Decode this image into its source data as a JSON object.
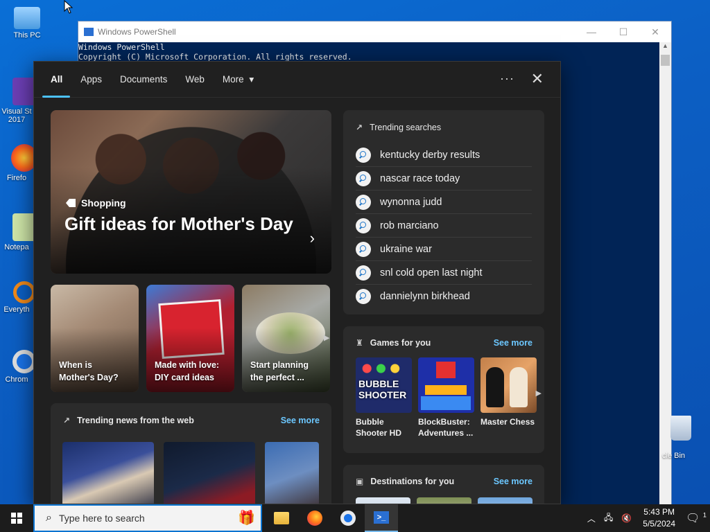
{
  "desktop": {
    "icons": [
      {
        "label": "This PC"
      },
      {
        "label": "Visual St 2017"
      },
      {
        "label": "Firefo"
      },
      {
        "label": "Notepa"
      },
      {
        "label": "Everyth"
      },
      {
        "label": "Chrom"
      }
    ],
    "recycle_bin": "cle Bin"
  },
  "powershell": {
    "title": "Windows PowerShell",
    "lines": [
      "Windows PowerShell",
      "Copyright (C) Microsoft Corporation. All rights reserved."
    ]
  },
  "search_panel": {
    "tabs": [
      {
        "label": "All",
        "active": true
      },
      {
        "label": "Apps"
      },
      {
        "label": "Documents"
      },
      {
        "label": "Web"
      },
      {
        "label": "More"
      }
    ],
    "more_caret": "▾",
    "dots": "···",
    "close": "✕",
    "hero": {
      "category": "Shopping",
      "title": "Gift ideas for Mother's Day",
      "arrow": "›"
    },
    "cards": [
      {
        "label": "When is Mother's Day?"
      },
      {
        "label": "Made with love: DIY card ideas"
      },
      {
        "label": "Start planning the perfect ..."
      }
    ],
    "trending_news": {
      "title": "Trending news from the web",
      "see_more": "See more"
    },
    "trending_searches": {
      "title": "Trending searches",
      "items": [
        "kentucky derby results",
        "nascar race today",
        "wynonna judd",
        "rob marciano",
        "ukraine war",
        "snl cold open last night",
        "dannielynn birkhead"
      ]
    },
    "games": {
      "title": "Games for you",
      "see_more": "See more",
      "items": [
        {
          "name": "Bubble Shooter HD",
          "art_text": "BUBBLE SHOOTER"
        },
        {
          "name": "BlockBuster: Adventures ..."
        },
        {
          "name": "Master Chess"
        }
      ]
    },
    "destinations": {
      "title": "Destinations for you",
      "see_more": "See more"
    }
  },
  "taskbar": {
    "search_placeholder": "Type here to search",
    "time": "5:43 PM",
    "date": "5/5/2024",
    "notification_count": "1"
  }
}
